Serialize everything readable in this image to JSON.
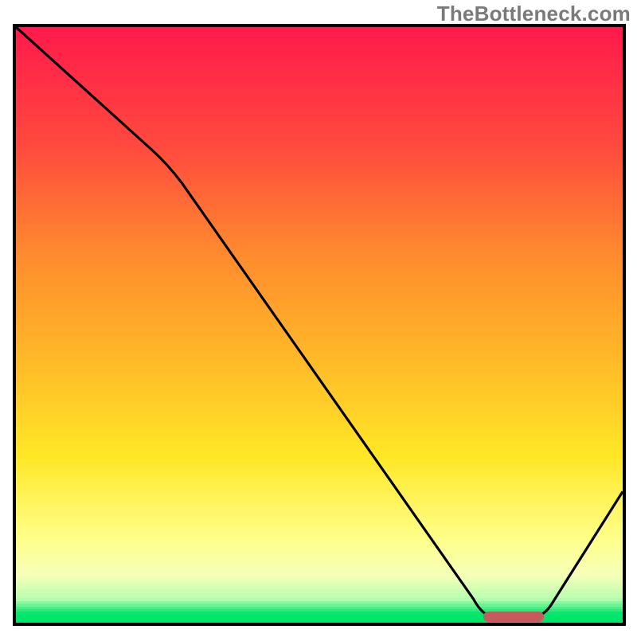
{
  "attribution": "TheBottleneck.com",
  "colors": {
    "red_top": "#ff1a4b",
    "red_mid": "#ff4a3e",
    "orange": "#ff8a2e",
    "yellow_orange": "#ffb728",
    "yellow": "#ffe726",
    "pale_yellow": "#ffff8a",
    "cream": "#f6ffb8",
    "mint": "#b7ffb0",
    "green": "#00e56a",
    "marker": "#c65a5c",
    "curve": "#000000",
    "frame": "#000000"
  },
  "chart_data": {
    "type": "line",
    "title": "",
    "xlabel": "",
    "ylabel": "",
    "xlim": [
      0,
      100
    ],
    "ylim": [
      0,
      100
    ],
    "x": [
      0,
      25,
      78,
      86,
      100
    ],
    "values": [
      100,
      77,
      1,
      1,
      22
    ],
    "marker_range_x": [
      77,
      87
    ],
    "marker_y": 1
  }
}
